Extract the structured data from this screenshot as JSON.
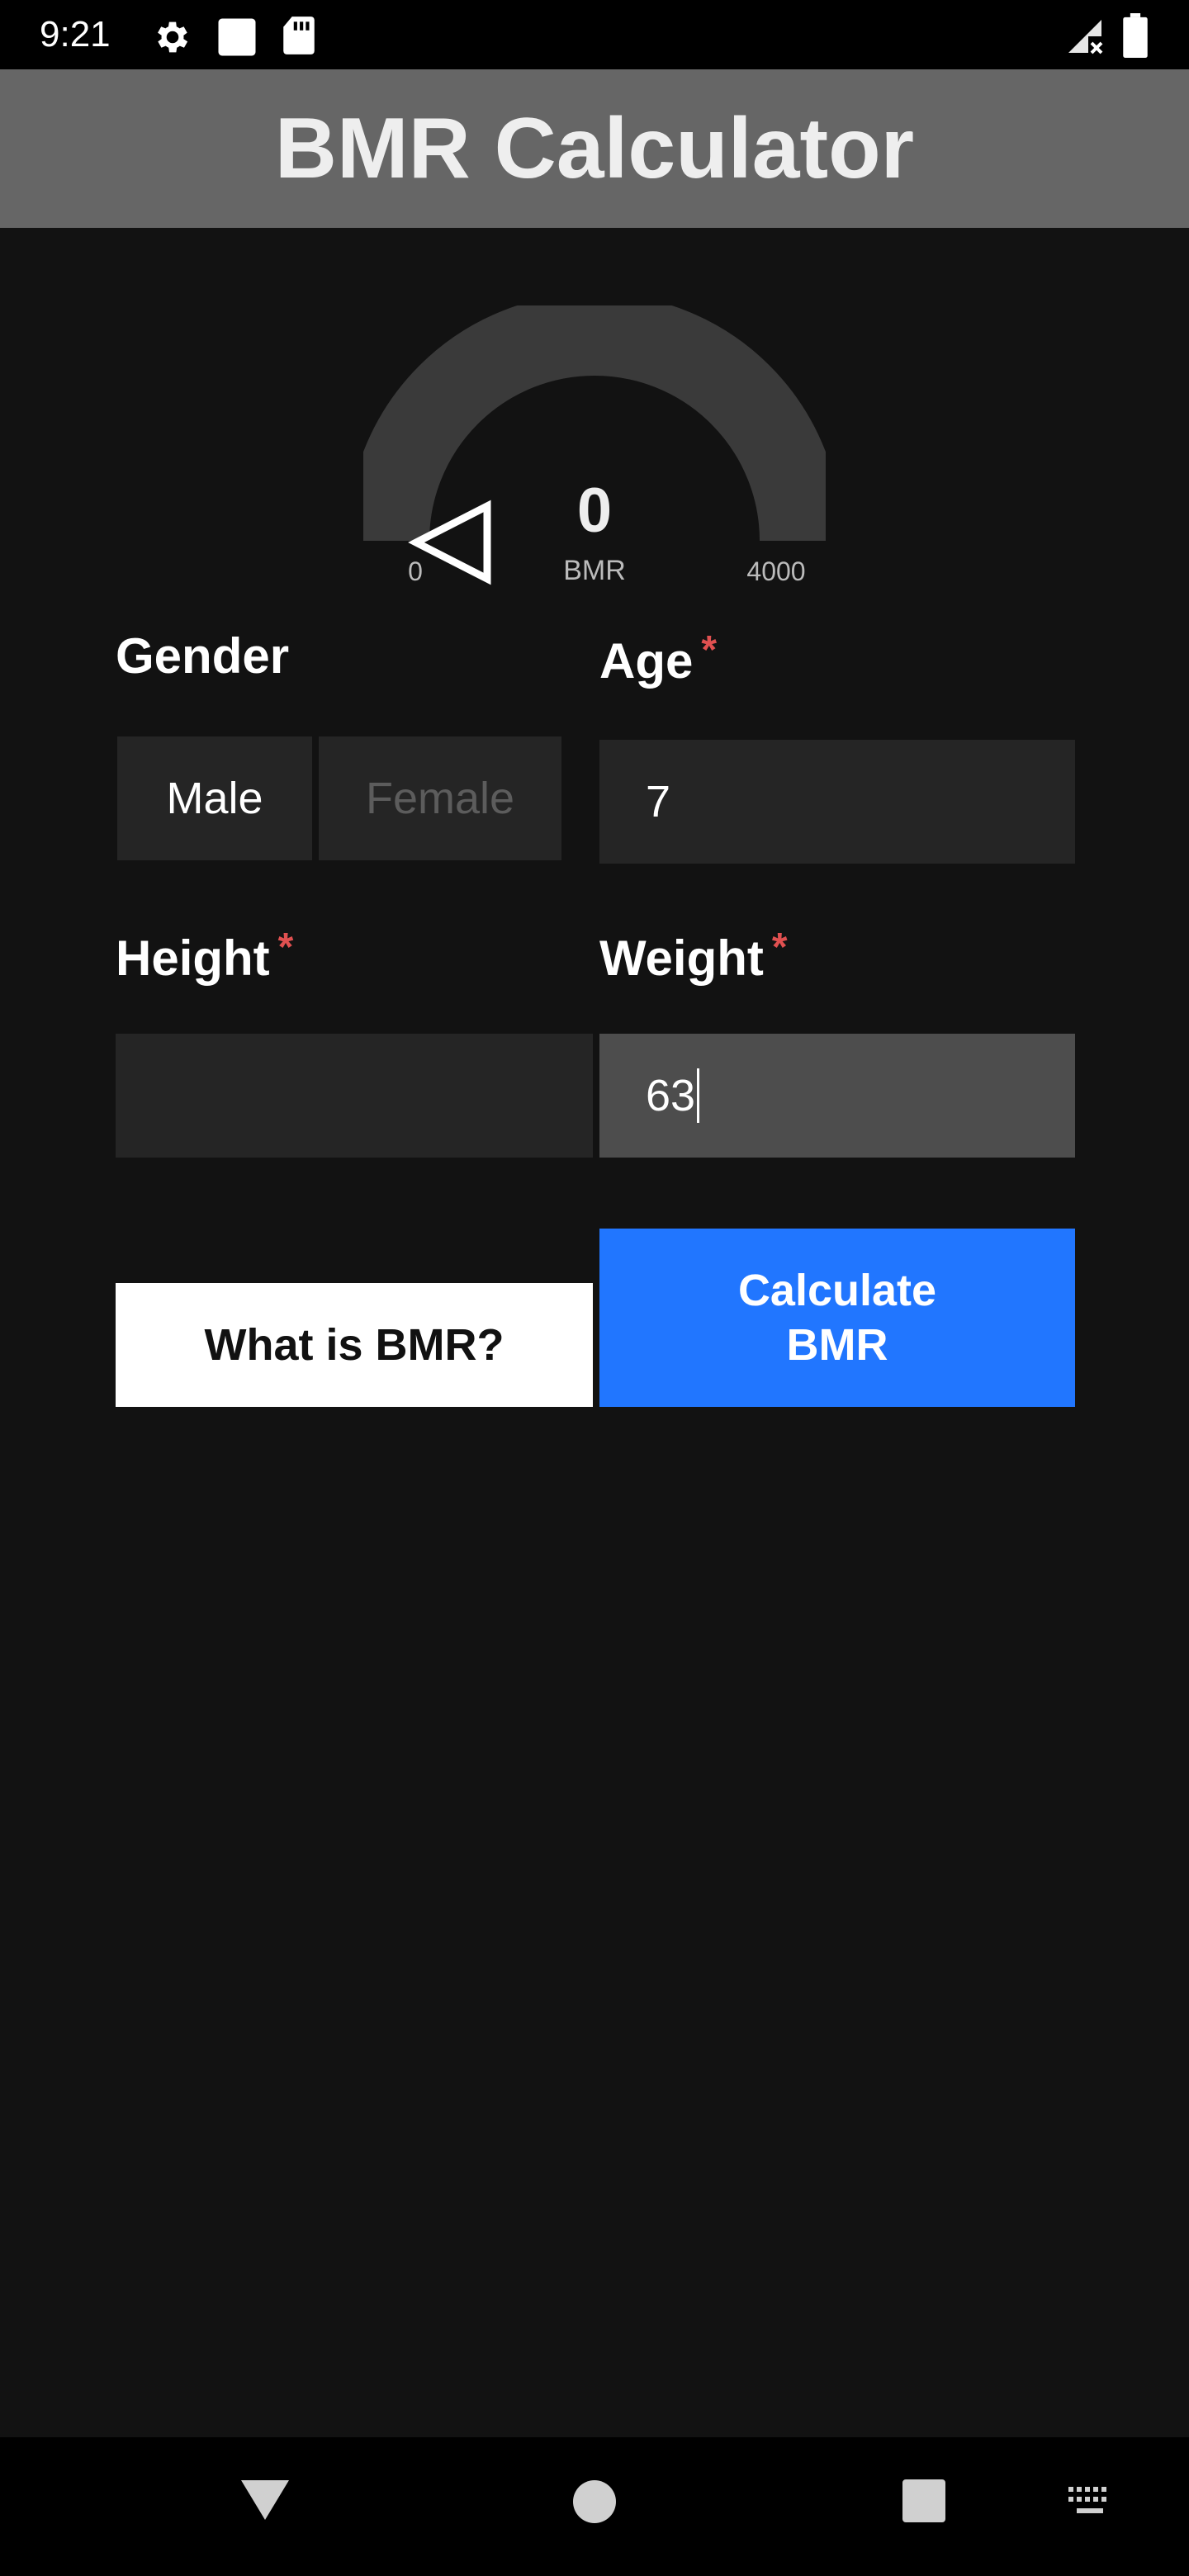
{
  "status_bar": {
    "time": "9:21",
    "icons": [
      "gear-icon",
      "square-icon",
      "sd-card-icon",
      "signal-no-service-icon",
      "battery-icon"
    ]
  },
  "app_bar": {
    "title": "BMR Calculator"
  },
  "gauge": {
    "value": "0",
    "unit": "BMR",
    "min": "0",
    "max": "4000",
    "level_fraction": 0,
    "track_color": "#3a3a3a",
    "pointer_icon": "triangle-pointer-icon"
  },
  "form": {
    "gender": {
      "label": "Gender",
      "options": [
        "Male",
        "Female"
      ],
      "selected": "Male"
    },
    "age": {
      "label": "Age",
      "required_mark": "*",
      "value": "7"
    },
    "height": {
      "label": "Height",
      "required_mark": "*",
      "value": ""
    },
    "weight": {
      "label": "Weight",
      "required_mark": "*",
      "value": "63"
    }
  },
  "buttons": {
    "what_is_bmr": "What is BMR?",
    "calculate_line1": "Calculate",
    "calculate_line2": "BMR"
  },
  "colors": {
    "background": "#121212",
    "app_bar": "#666666",
    "accent": "#2176ff",
    "required": "#e05050"
  },
  "nav_bar": {
    "icons": [
      "back-icon",
      "home-icon",
      "recents-icon",
      "keyboard-icon"
    ]
  }
}
